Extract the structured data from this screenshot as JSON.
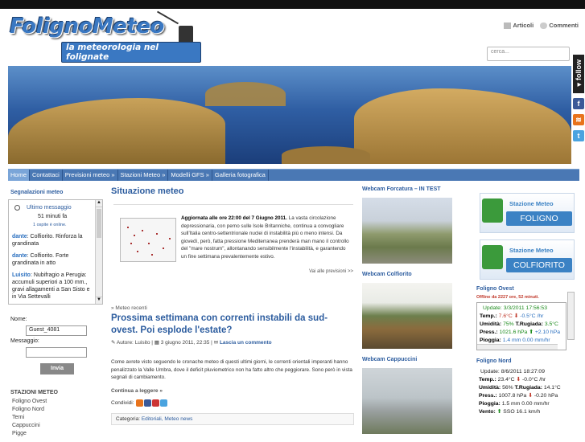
{
  "header": {
    "logo_title": "FolignoMeteo",
    "logo_subtitle": "la meteorologia nel folignate",
    "feeds": {
      "articles": "Articoli",
      "comments": "Commenti"
    },
    "search_placeholder": "cerca...",
    "follow_label": "follow"
  },
  "nav": [
    "Home",
    "Contattaci",
    "Previsioni meteo »",
    "Stazioni Meteo »",
    "Modelli GFS »",
    "Galleria fotografica"
  ],
  "sidebar": {
    "shoutbox_title": "Segnalazioni meteo",
    "last_message_label": "Ultimo messaggio",
    "last_message_time": "51 minuti fa",
    "online": "1 ospite è online.",
    "messages": [
      {
        "user": "dante",
        "text": ": Colfiorito. Rinforza la grandinata"
      },
      {
        "user": "dante",
        "text": ": Colfiorito. Forte grandinata in atto"
      },
      {
        "user": "Luisito",
        "text": ": Nubifragio a Perugia: accumuli superiori a 100 mm., gravi allagamenti a San Sisto e in Via Settevalli"
      }
    ],
    "name_label": "Nome:",
    "name_value": "Guest_4081",
    "message_label": "Messaggio:",
    "send_label": "Invia",
    "stations_title": "STAZIONI METEO",
    "stations": [
      "Foligno Ovest",
      "Foligno Nord",
      "Terni",
      "Cappuccini",
      "Pigge"
    ]
  },
  "main": {
    "situation_title": "Situazione meteo",
    "situation_lead": "Aggiornata alle ore 22:00 del 7 Giugno 2011.",
    "situation_text": " La vasta circolazione depressionaria, con perno sulle Isole Britanniche, continua a convogliare sull'Italia centro-settentrionale nuclei di instabilità più o meno intensi. Da giovedì, però, fatta pressione Mediterranea prenderà man mano il controllo del \"mare nostrum\", allontanando sensibilmente l'instabilità, e garantendo un fine settimana prevalentemente estivo.",
    "more_forecasts": "Vai alle previsioni >>",
    "recent_label": "» Meteo recenti",
    "post_title": "Prossima settimana con correnti instabili da sud-ovest. Poi esplode l'estate?",
    "post_author_label": "Autore:",
    "post_author": "Luisito",
    "post_date": "3 giugno 2011, 22:35",
    "post_comment": "Lascia un commento",
    "post_body": "Come avrete visto seguendo le cronache meteo di questi ultimi giorni, le correnti orientali imperanti hanno penalizzato la Valle Umbra, dove il deficit pluviometrico non ha fatto altro che peggiorare. Sono però in vista segnali di cambiamento.",
    "continue_label": "Continua a leggere »",
    "share_label": "Condividi:",
    "categories_label": "Categoria:",
    "categories": "Editoriali, Meteo news"
  },
  "webcams": [
    "Webcam Forcatura – IN TEST",
    "Webcam Colfiorito",
    "Webcam Cappuccini"
  ],
  "right": {
    "badge_small": "Stazione Meteo",
    "badge1": "FOLIGNO",
    "badge2": "COLFIORITO",
    "ovest_title": "Foligno Ovest",
    "ovest_offline": "Offline da 2227 ore, 52 minuti.",
    "ovest": {
      "update": "Update:  3/3/2011  17:56:53",
      "temp": "7.6°C",
      "temp_trend": "-0.5°C /hr",
      "umid": "75%",
      "rugiada": "3.5°C",
      "press": "1021.6 hPa",
      "press_trend": "+2.10 hPa",
      "pioggia": "1.4 mm",
      "pioggia_rate": "0.00 mm/hr"
    },
    "nord_title": "Foligno Nord",
    "nord": {
      "update": "Update:  8/6/2011  18:27:09",
      "temp": "23.4°C",
      "temp_trend": "-0.0°C /hr",
      "umid": "56%",
      "rugiada": "14.1°C",
      "press": "1007.8 hPa",
      "press_trend": "-0.20 hPa",
      "pioggia": "1.5 mm",
      "pioggia_rate": "0.00 mm/hr",
      "vento": "SSO  16.1 km/h"
    },
    "labels": {
      "temp": "Temp.:",
      "umid": "Umidità:",
      "rugiada": "T.Rugiada:",
      "press": "Press.:",
      "pioggia": "Pioggia:",
      "vento": "Vento:"
    }
  }
}
